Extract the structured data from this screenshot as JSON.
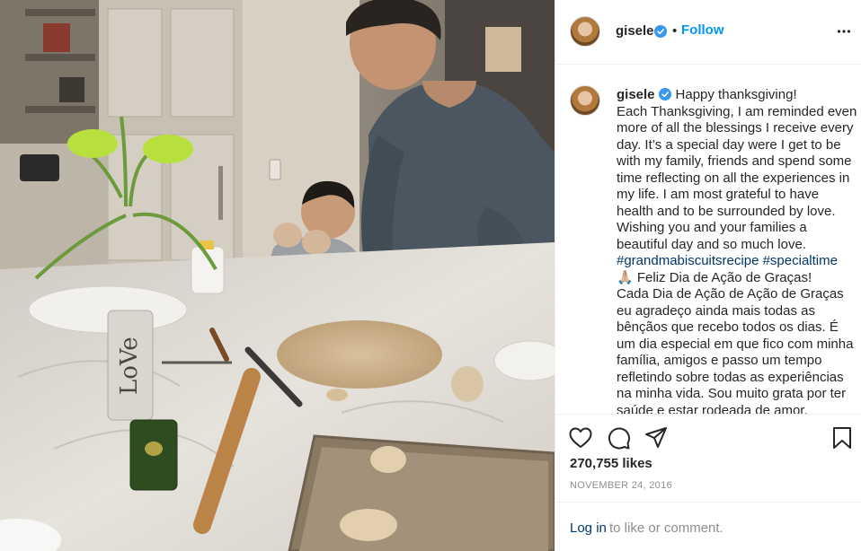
{
  "header": {
    "username": "gisele",
    "separator": "•",
    "follow_label": "Follow"
  },
  "caption": {
    "username": "gisele",
    "lines": [
      "Happy thanksgiving!",
      "Each Thanksgiving, I am reminded even",
      "more of all the blessings I receive every",
      "day. It’s a special day were I get to be",
      "with my family, friends and spend some",
      "time reflecting on all the experiences in",
      "my life. I am most grateful to have",
      "health and to be surrounded by love.",
      "Wishing you and your families a",
      "beautiful day and so much love."
    ],
    "hashtags": [
      "#grandmabiscuitsrecipe",
      "#specialtime"
    ],
    "pt_emoji": "🙏🏼",
    "pt_lines": [
      "Feliz Dia de Ação de Graças!",
      "Cada Dia de Ação de Ação de Graças",
      "eu agradeço ainda mais todas as",
      "bênçãos que recebo todos os dias. É",
      "um dia especial em que fico com minha",
      "família, amigos e passo um tempo",
      "refletindo sobre todas as experiências",
      "na minha vida. Sou muito grata por ter",
      "saúde e estar rodeada de amor."
    ]
  },
  "engagement": {
    "likes": "270,755 likes",
    "date": "NOVEMBER 24, 2016"
  },
  "login": {
    "link": "Log in",
    "rest": "to like or comment."
  },
  "colors": {
    "accent": "#0095f6",
    "link": "#00376b",
    "text": "#262626",
    "muted": "#8e8e8e",
    "verified": "#3897f0"
  },
  "icons": {
    "verified": "verified-badge-icon",
    "more": "more-options-icon",
    "like": "heart-icon",
    "comment": "comment-bubble-icon",
    "share": "paper-plane-icon",
    "save": "bookmark-icon"
  }
}
